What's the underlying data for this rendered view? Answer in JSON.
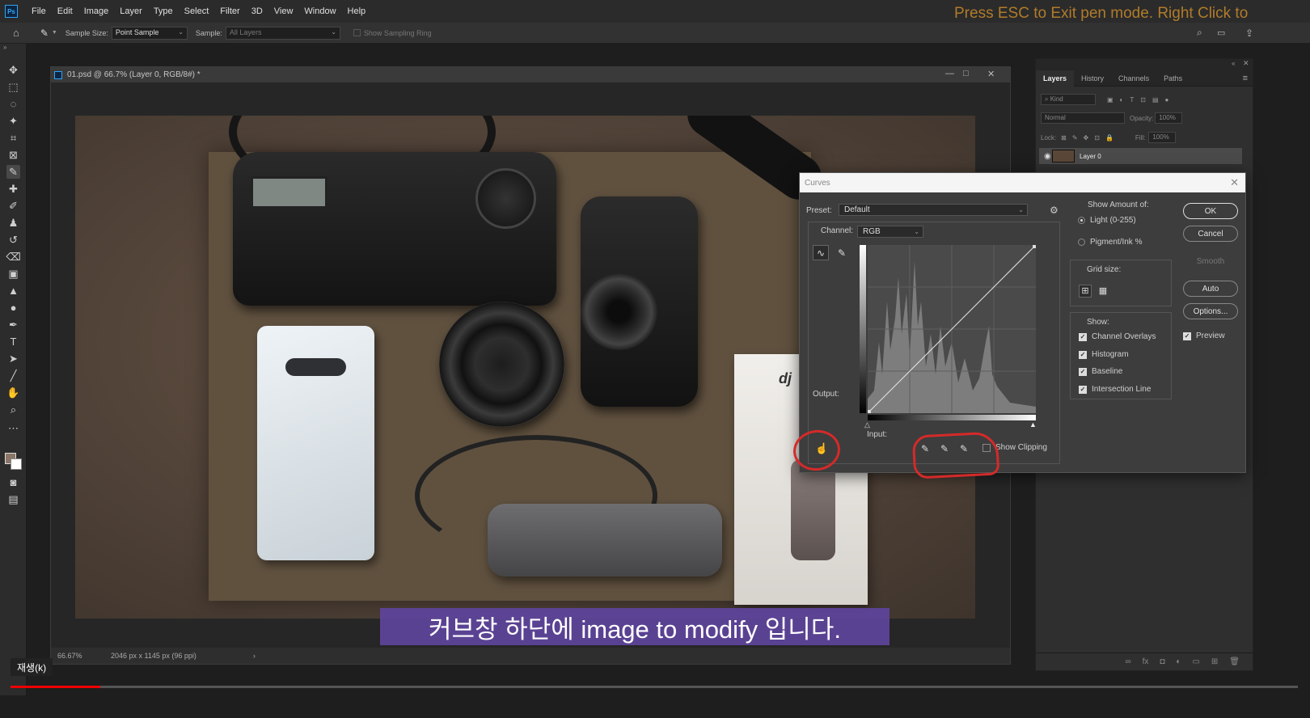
{
  "app": {
    "logo": "Ps",
    "esc_hint": "Press ESC to Exit pen mode.  Right Click to"
  },
  "menu": [
    "File",
    "Edit",
    "Image",
    "Layer",
    "Type",
    "Select",
    "Filter",
    "3D",
    "View",
    "Window",
    "Help"
  ],
  "options_bar": {
    "sample_size_label": "Sample Size:",
    "sample_size_value": "Point Sample",
    "sample_label": "Sample:",
    "sample_value": "All Layers",
    "sampling_ring_label": "Show Sampling Ring"
  },
  "document": {
    "title": "01.psd @ 66.7% (Layer 0, RGB/8#) *",
    "zoom": "66.67%",
    "info": "2046 px x 1145 px (96 ppi)"
  },
  "subtitle": "커브창 하단에 image to modify 입니다.",
  "panel": {
    "tabs": [
      "Layers",
      "History",
      "Channels",
      "Paths"
    ],
    "kind_placeholder": "Kind",
    "blend_mode": "Normal",
    "opacity_label": "Opacity:",
    "opacity_value": "100%",
    "lock_label": "Lock:",
    "fill_label": "Fill:",
    "fill_value": "100%",
    "layer_name": "Layer 0"
  },
  "curves": {
    "title": "Curves",
    "preset_label": "Preset:",
    "preset_value": "Default",
    "channel_label": "Channel:",
    "channel_value": "RGB",
    "output_label": "Output:",
    "input_label": "Input:",
    "show_clipping_label": "Show Clipping",
    "show_clipping": false,
    "show_amount_title": "Show Amount of:",
    "light_label": "Light  (0-255)",
    "pigment_label": "Pigment/Ink %",
    "grid_size_title": "Grid size:",
    "show_title": "Show:",
    "show_options": [
      {
        "label": "Channel Overlays",
        "checked": true
      },
      {
        "label": "Histogram",
        "checked": true
      },
      {
        "label": "Baseline",
        "checked": true
      },
      {
        "label": "Intersection Line",
        "checked": true
      }
    ],
    "buttons": {
      "ok": "OK",
      "cancel": "Cancel",
      "smooth": "Smooth",
      "auto": "Auto",
      "options": "Options..."
    },
    "preview_label": "Preview",
    "preview": true
  },
  "video": {
    "play_label": "재생(k)",
    "progress": 0.07
  },
  "colors": {
    "accent_annotation": "#d42a2a",
    "subtitle_bg": "#5e449c",
    "progress": "#ee0000"
  }
}
